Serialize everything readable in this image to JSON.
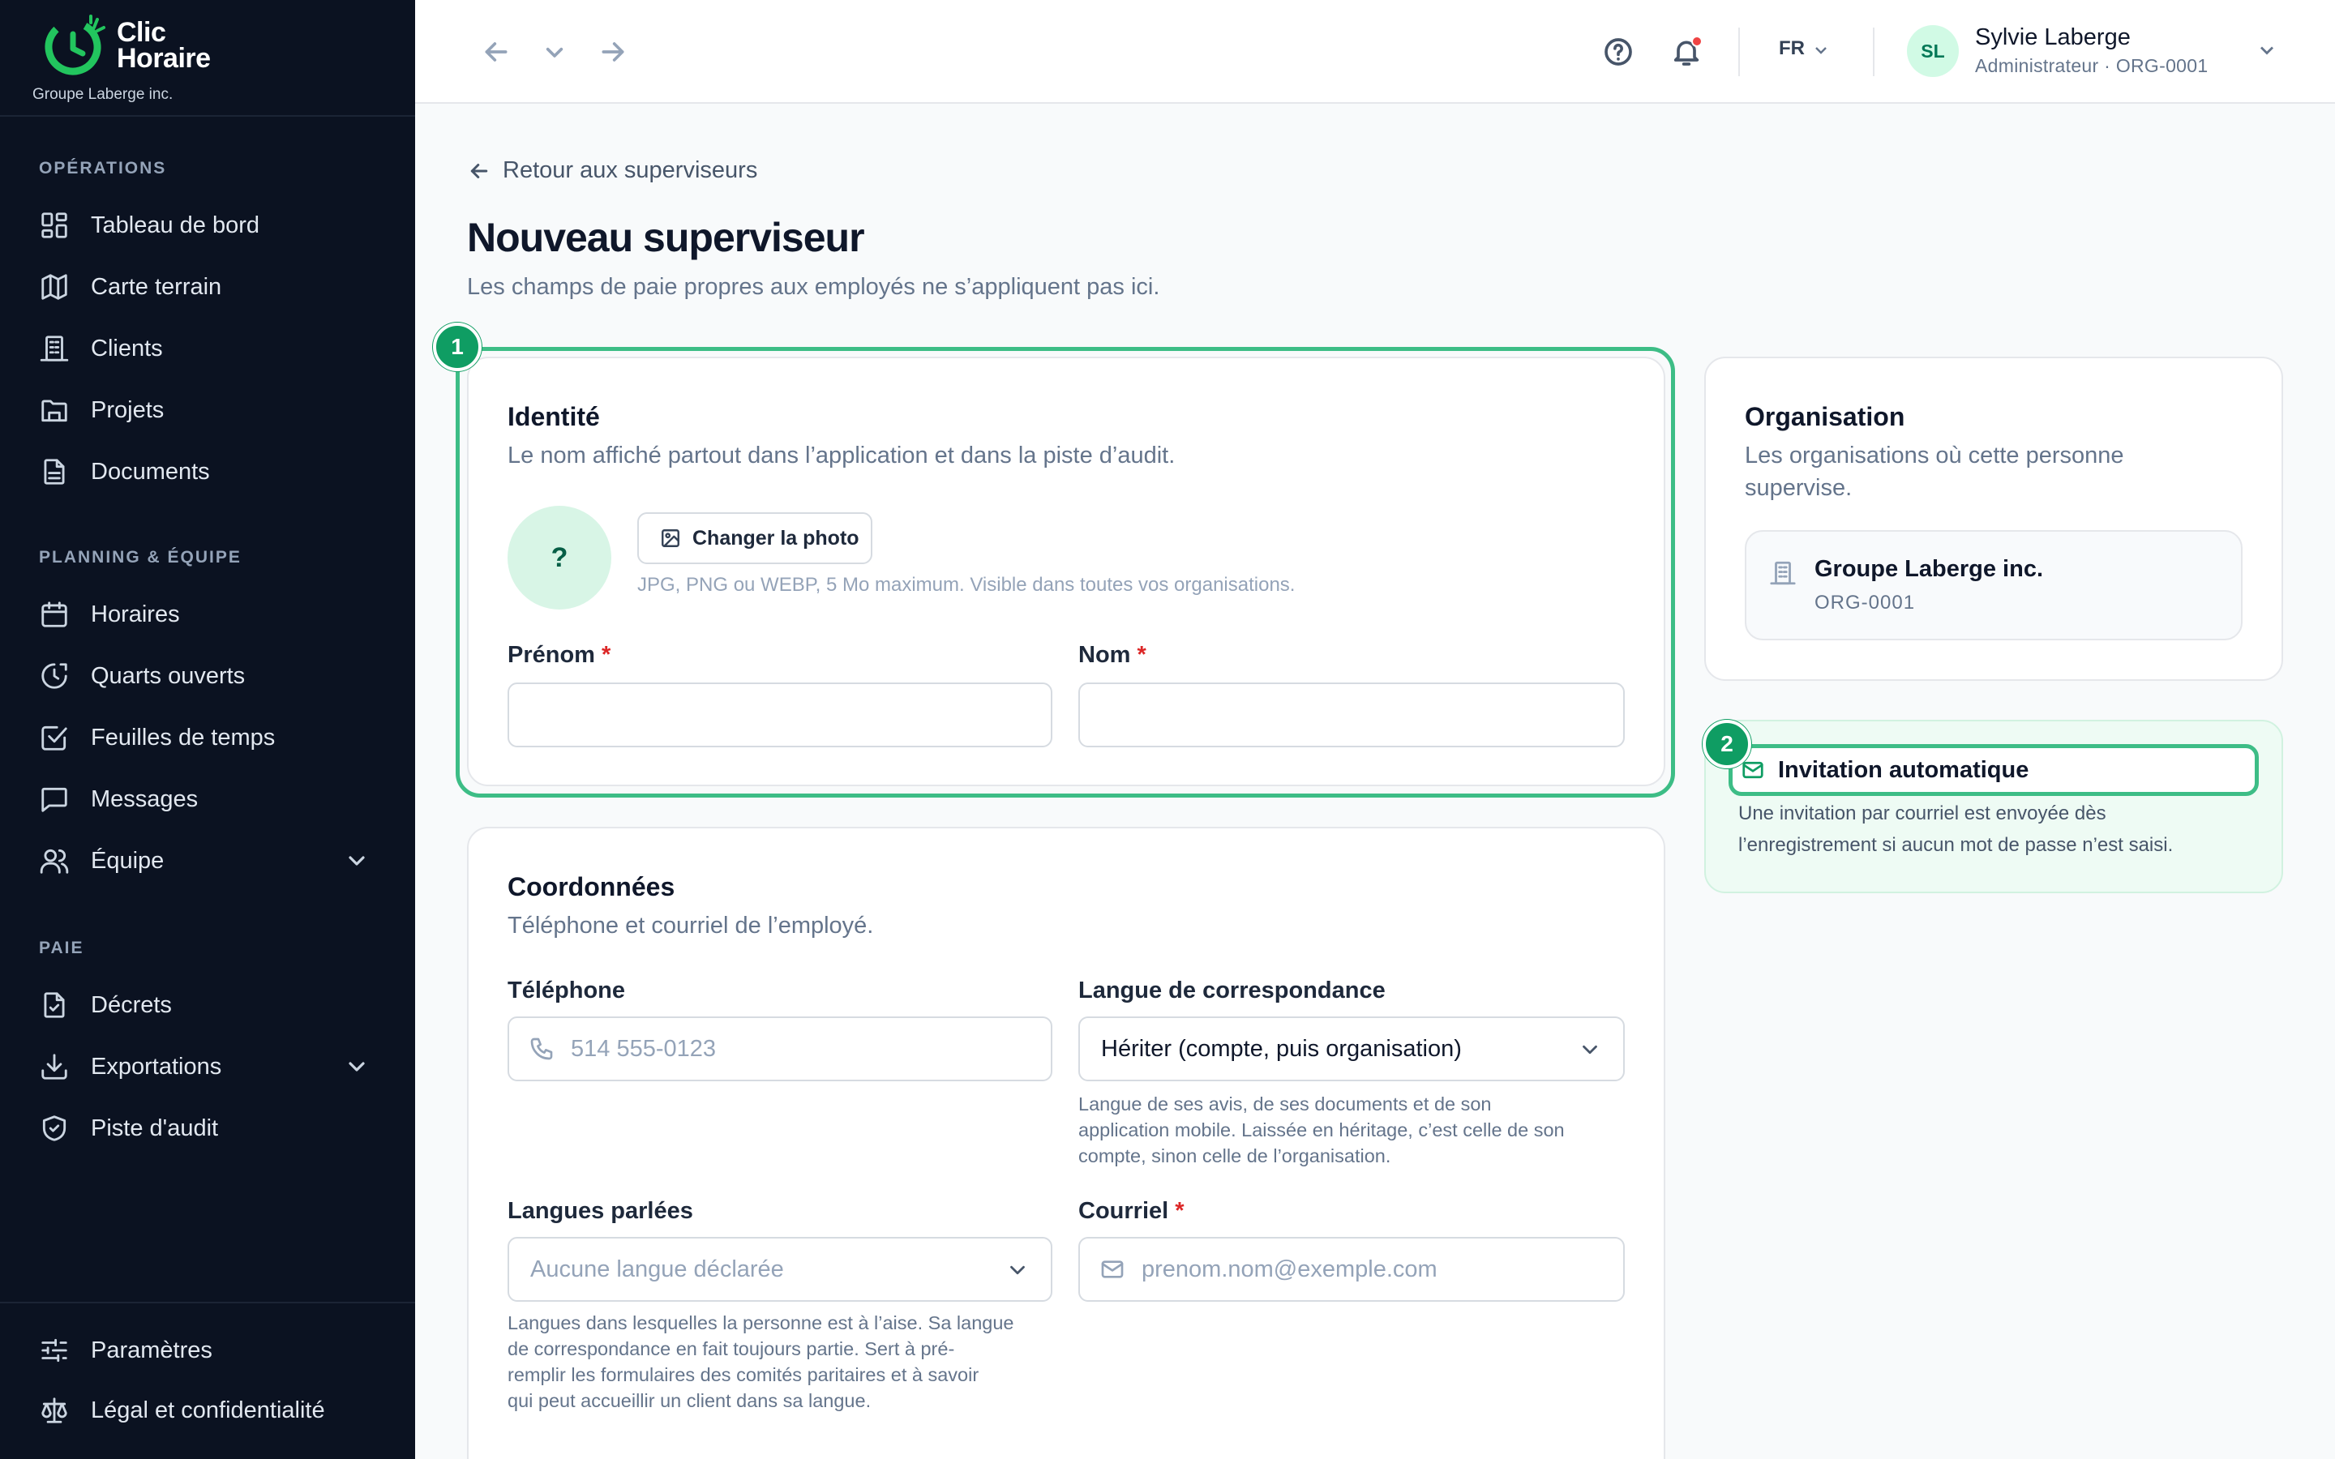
{
  "brand": {
    "name_line1": "Clic",
    "name_line2": "Horaire",
    "org": "Groupe Laberge inc."
  },
  "sidebar": {
    "sections": [
      {
        "label": "OPÉRATIONS"
      },
      {
        "label": "PLANNING & ÉQUIPE"
      },
      {
        "label": "PAIE"
      }
    ],
    "items": [
      {
        "label": "Tableau de bord",
        "icon": "dashboard-icon"
      },
      {
        "label": "Carte terrain",
        "icon": "map-icon"
      },
      {
        "label": "Clients",
        "icon": "building-icon"
      },
      {
        "label": "Projets",
        "icon": "folder-icon"
      },
      {
        "label": "Documents",
        "icon": "document-icon"
      },
      {
        "label": "Horaires",
        "icon": "calendar-icon"
      },
      {
        "label": "Quarts ouverts",
        "icon": "clock-icon"
      },
      {
        "label": "Feuilles de temps",
        "icon": "checkbox-icon"
      },
      {
        "label": "Messages",
        "icon": "message-icon"
      },
      {
        "label": "Équipe",
        "icon": "users-icon"
      },
      {
        "label": "Décrets",
        "icon": "file-check-icon"
      },
      {
        "label": "Exportations",
        "icon": "download-icon"
      },
      {
        "label": "Piste d'audit",
        "icon": "shield-icon"
      },
      {
        "label": "Paramètres",
        "icon": "sliders-icon"
      },
      {
        "label": "Légal et confidentialité",
        "icon": "scale-icon"
      }
    ]
  },
  "topbar": {
    "lang": "FR",
    "user_initials": "SL",
    "user_name": "Sylvie Laberge",
    "user_role": "Administrateur · ORG-0001"
  },
  "page": {
    "back": "Retour aux superviseurs",
    "title": "Nouveau superviseur",
    "subtitle": "Les champs de paie propres aux employés ne s’appliquent pas ici."
  },
  "identity": {
    "step": "1",
    "title": "Identité",
    "desc": "Le nom affiché partout dans l’application et dans la piste d’audit.",
    "photo_placeholder": "?",
    "photo_button": "Changer la photo",
    "photo_help": "JPG, PNG ou WEBP, 5 Mo maximum. Visible dans toutes vos organisations.",
    "first_name_label": "Prénom",
    "last_name_label": "Nom",
    "required_mark": "*"
  },
  "contact": {
    "title": "Coordonnées",
    "desc": "Téléphone et courriel de l’employé.",
    "phone_label": "Téléphone",
    "phone_placeholder": "514 555-0123",
    "corr_lang_label": "Langue de correspondance",
    "corr_lang_value": "Hériter (compte, puis organisation)",
    "corr_lang_help_1": "Langue de ses avis, de ses documents et de son",
    "corr_lang_help_2": "application mobile. Laissée en héritage, c’est celle de son",
    "corr_lang_help_3": "compte, sinon celle de l’organisation.",
    "spoken_label": "Langues parlées",
    "spoken_placeholder": "Aucune langue déclarée",
    "spoken_help_1": "Langues dans lesquelles la personne est à l’aise. Sa langue",
    "spoken_help_2": "de correspondance en fait toujours partie. Sert à pré-",
    "spoken_help_3": "remplir les formulaires des comités paritaires et à savoir",
    "spoken_help_4": "qui peut accueillir un client dans sa langue.",
    "email_label": "Courriel",
    "email_placeholder": "prenom.nom@exemple.com"
  },
  "organisation": {
    "title": "Organisation",
    "desc_1": "Les organisations où cette personne",
    "desc_2": "supervise.",
    "org_name": "Groupe Laberge inc.",
    "org_code": "ORG-0001"
  },
  "invitation": {
    "step": "2",
    "title": "Invitation automatique",
    "text_1": "Une invitation par courriel est envoyée dès",
    "text_2": "l’enregistrement si aucun mot de passe n’est saisi."
  },
  "colors": {
    "accent": "#0f9d63",
    "highlight": "#3dbd86",
    "sidebar": "#0b1221",
    "required": "#dc2626"
  }
}
